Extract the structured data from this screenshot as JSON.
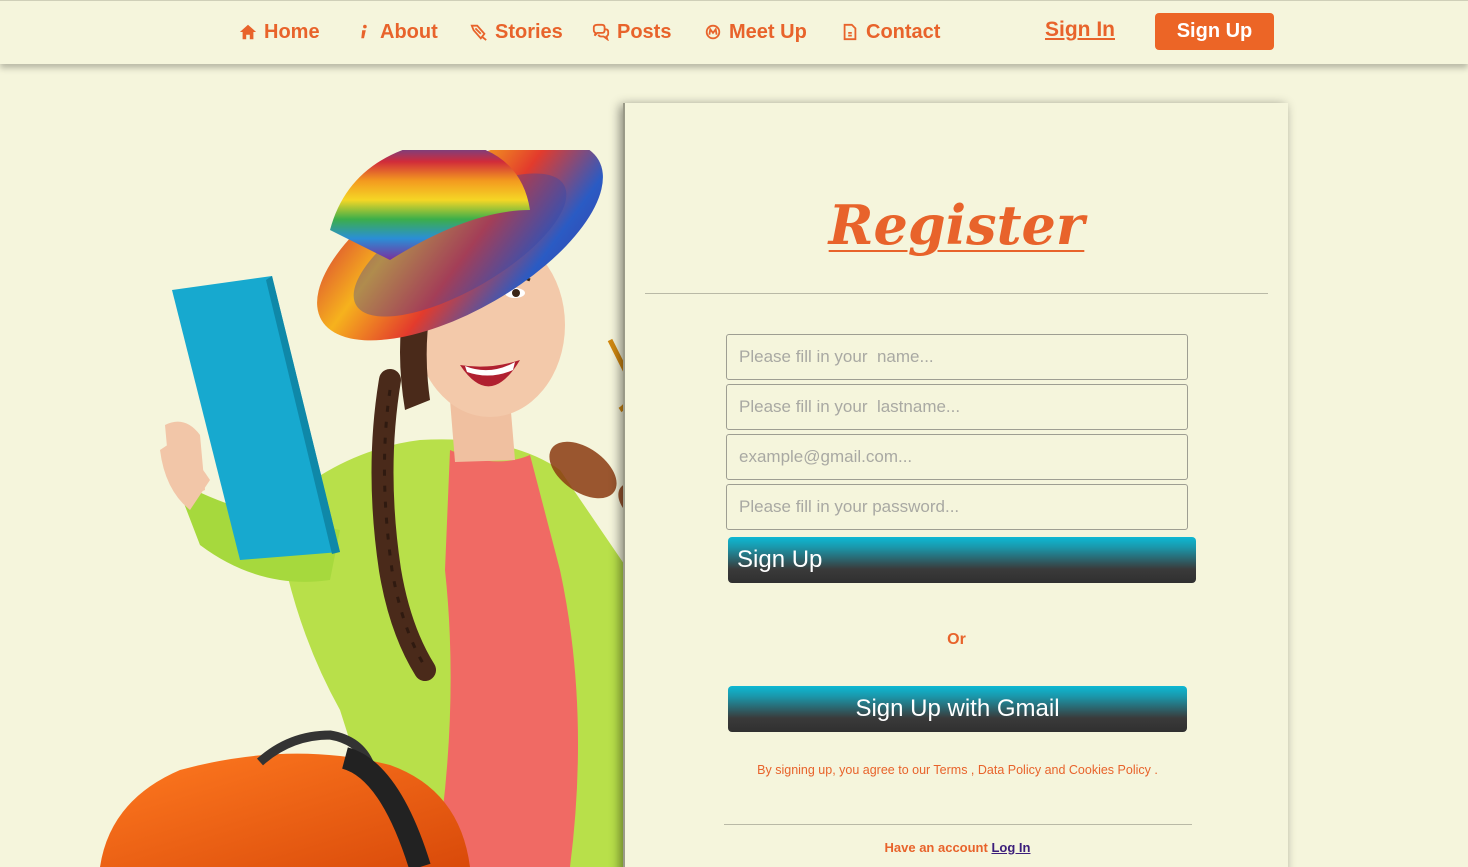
{
  "nav": {
    "items": [
      {
        "label": "Home",
        "icon": "home-icon"
      },
      {
        "label": "About",
        "icon": "info-icon"
      },
      {
        "label": "Stories",
        "icon": "stories-icon"
      },
      {
        "label": "Posts",
        "icon": "chat-icon"
      },
      {
        "label": "Meet Up",
        "icon": "meetup-icon"
      },
      {
        "label": "Contact",
        "icon": "document-icon"
      }
    ],
    "sign_in": "Sign In",
    "sign_up": "Sign Up"
  },
  "form": {
    "title": "Register",
    "name_placeholder": "Please fill in your  name...",
    "lastname_placeholder": "Please fill in your  lastname...",
    "email_placeholder": "example@gmail.com...",
    "password_placeholder": "Please fill in your password...",
    "signup_button": "Sign Up",
    "or_label": "Or",
    "gmail_button": "Sign Up with Gmail",
    "terms_text": "By signing up, you agree to our Terms , Data Policy and Cookies Policy .",
    "have_account": "Have an account",
    "login_link": "Log In"
  },
  "colors": {
    "accent": "#e8632b",
    "background": "#f5f5dc",
    "button_top": "#0db8d3",
    "button_bottom": "#303030",
    "login_link": "#3b1d7a"
  }
}
